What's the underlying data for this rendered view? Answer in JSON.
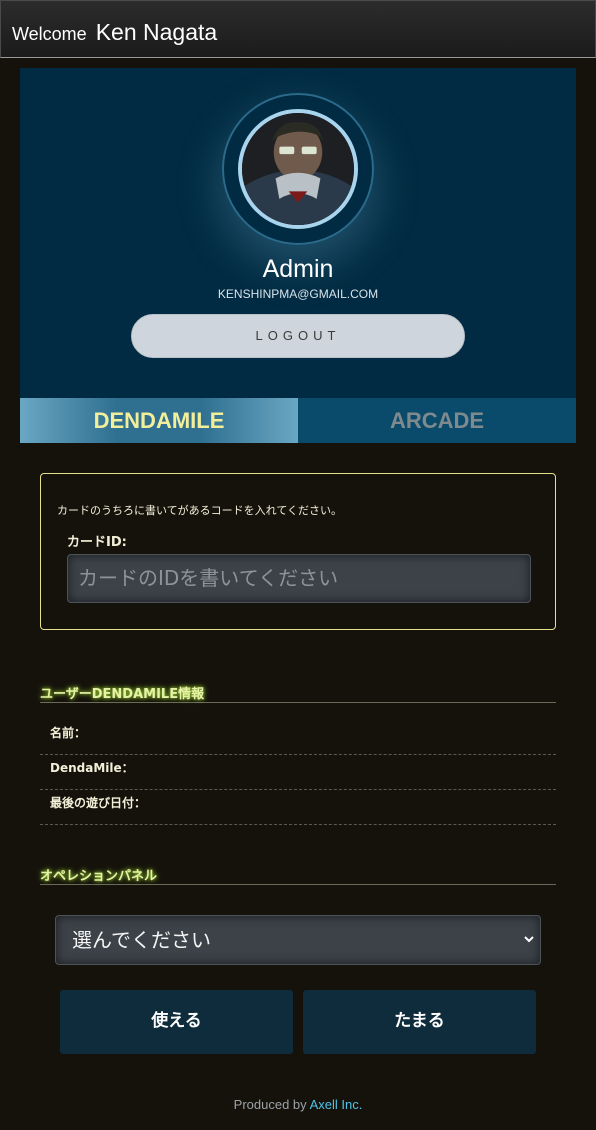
{
  "header": {
    "welcome_label": "Welcome",
    "user_name": "Ken Nagata"
  },
  "profile": {
    "display_name": "Admin",
    "email": "KENSHINPMA@GMAIL.COM",
    "logout_label": "LOGOUT"
  },
  "tabs": [
    {
      "label": "DENDAMILE",
      "active": true
    },
    {
      "label": "ARCADE",
      "active": false
    }
  ],
  "card_form": {
    "hint": "カードのうちろに書いてがあるコードを入れてください。",
    "label": "カードID:",
    "input_placeholder": "カードのIDを書いてください",
    "input_value": ""
  },
  "user_info": {
    "title": "ユーザーDENDAMILE情報",
    "rows": [
      {
        "label": "名前：",
        "value": ""
      },
      {
        "label": "DendaMile：",
        "value": ""
      },
      {
        "label": "最後の遊び日付：",
        "value": ""
      }
    ]
  },
  "operation_panel": {
    "title": "オペレションパネル",
    "select_value": "選んでください",
    "buttons": [
      "使える",
      "たまる"
    ]
  },
  "footer": {
    "produced_by": "Produced by",
    "company": "Axell Inc."
  },
  "colors": {
    "page_bg": "#15120c",
    "profile_bg": "#012b42",
    "active_tab_text": "#f2ee9a",
    "section_glow": "#9acd32",
    "button_bg": "#0e2c3c",
    "link": "#4fc3e8"
  },
  "icons": {
    "select_arrow": "chevron-down-icon"
  }
}
